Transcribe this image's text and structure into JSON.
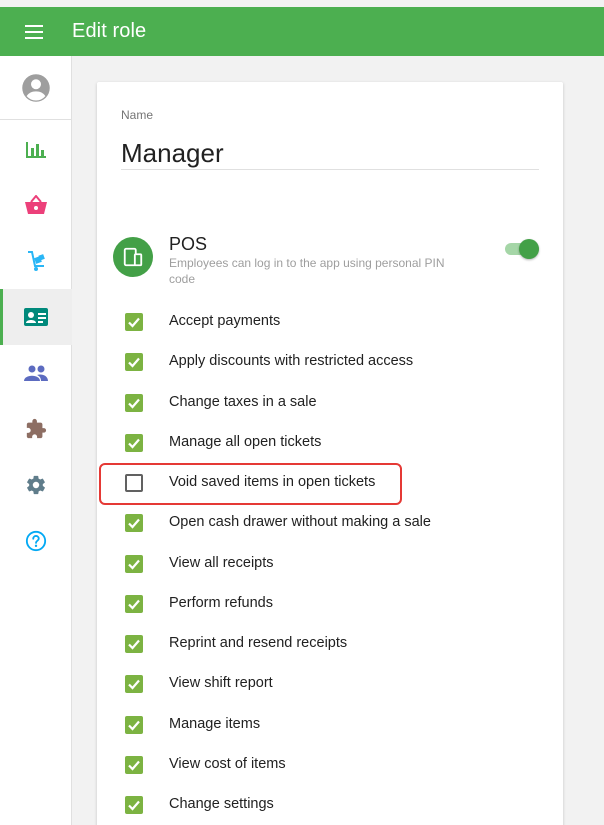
{
  "header": {
    "title": "Edit role",
    "menu_icon": "hamburger-menu-icon"
  },
  "sidebar": {
    "items": [
      {
        "icon": "account-circle-icon",
        "color": "#9e9e9e"
      },
      {
        "icon": "bar-chart-icon",
        "color": "#4caf50"
      },
      {
        "icon": "basket-icon",
        "color": "#ec407a"
      },
      {
        "icon": "inventory-cart-icon",
        "color": "#29b6f6"
      },
      {
        "icon": "employee-card-icon",
        "color": "#00897b",
        "active": true
      },
      {
        "icon": "customers-icon",
        "color": "#5c6bc0"
      },
      {
        "icon": "integrations-puzzle-icon",
        "color": "#8d6e63"
      },
      {
        "icon": "settings-gear-icon",
        "color": "#607d8b"
      },
      {
        "icon": "help-icon",
        "color": "#03a9f4"
      }
    ]
  },
  "form": {
    "name_label": "Name",
    "name_value": "Manager"
  },
  "pos": {
    "title": "POS",
    "description": "Employees can log in to the app using personal PIN code",
    "enabled": true
  },
  "permissions": [
    {
      "label": "Accept payments",
      "checked": true
    },
    {
      "label": "Apply discounts with restricted access",
      "checked": true
    },
    {
      "label": "Change taxes in a sale",
      "checked": true
    },
    {
      "label": "Manage all open tickets",
      "checked": true
    },
    {
      "label": "Void saved items in open tickets",
      "checked": false
    },
    {
      "label": "Open cash drawer without making a sale",
      "checked": true
    },
    {
      "label": "View all receipts",
      "checked": true
    },
    {
      "label": "Perform refunds",
      "checked": true
    },
    {
      "label": "Reprint and resend receipts",
      "checked": true
    },
    {
      "label": "View shift report",
      "checked": true
    },
    {
      "label": "Manage items",
      "checked": true
    },
    {
      "label": "View cost of items",
      "checked": true
    },
    {
      "label": "Change settings",
      "checked": true
    }
  ],
  "colors": {
    "accent": "#4caf50",
    "checkbox": "#7cb342",
    "highlight": "#e53935"
  }
}
